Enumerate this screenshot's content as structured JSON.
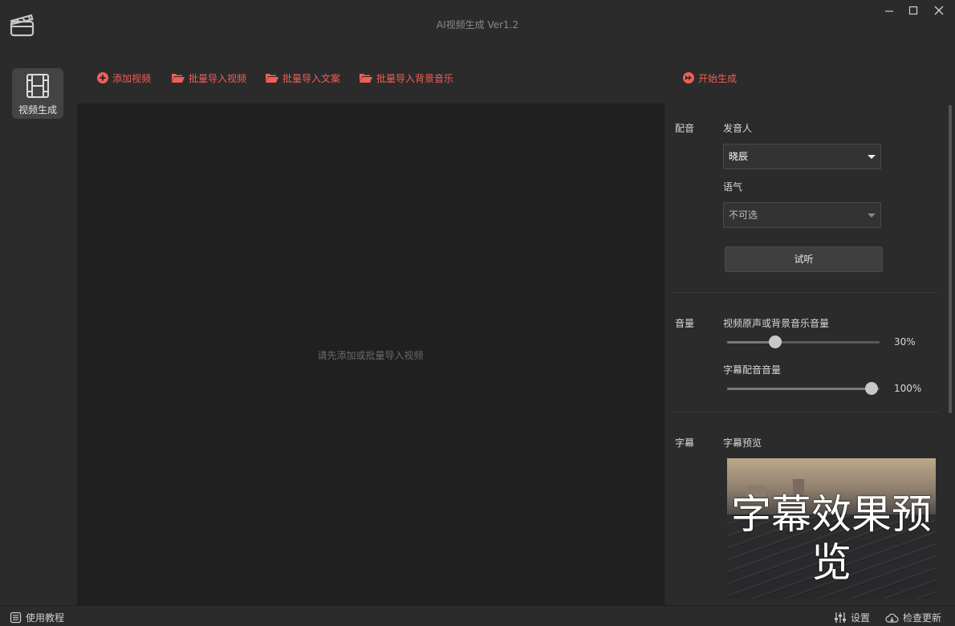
{
  "window": {
    "title": "AI视频生成 Ver1.2",
    "app_icon": "clapperboard-icon",
    "controls": [
      "minimize-icon",
      "maximize-icon",
      "close-icon"
    ]
  },
  "sidebar": {
    "items": [
      {
        "label": "视频生成",
        "icon": "film-icon",
        "active": true
      }
    ]
  },
  "toolbar": {
    "accent_color": "#ef5f57",
    "add_video": "添加视频",
    "import_videos": "批量导入视频",
    "import_texts": "批量导入文案",
    "import_music": "批量导入背景音乐",
    "start": "开始生成"
  },
  "main": {
    "empty_hint": "请先添加或批量导入视频"
  },
  "panel": {
    "voice": {
      "section_label": "配音",
      "speaker_label": "发音人",
      "speaker_value": "晓辰",
      "tone_label": "语气",
      "tone_value": "不可选",
      "listen_button": "试听"
    },
    "volume": {
      "section_label": "音量",
      "bg_label": "视频原声或背景音乐音量",
      "bg_value": 30,
      "bg_text": "30%",
      "dub_label": "字幕配音音量",
      "dub_value": 100,
      "dub_text": "100%"
    },
    "subtitle": {
      "section_label": "字幕",
      "preview_label": "字幕预览",
      "preview_text": "字幕效果预览"
    }
  },
  "statusbar": {
    "tutorial": "使用教程",
    "settings": "设置",
    "check_update": "检查更新"
  }
}
